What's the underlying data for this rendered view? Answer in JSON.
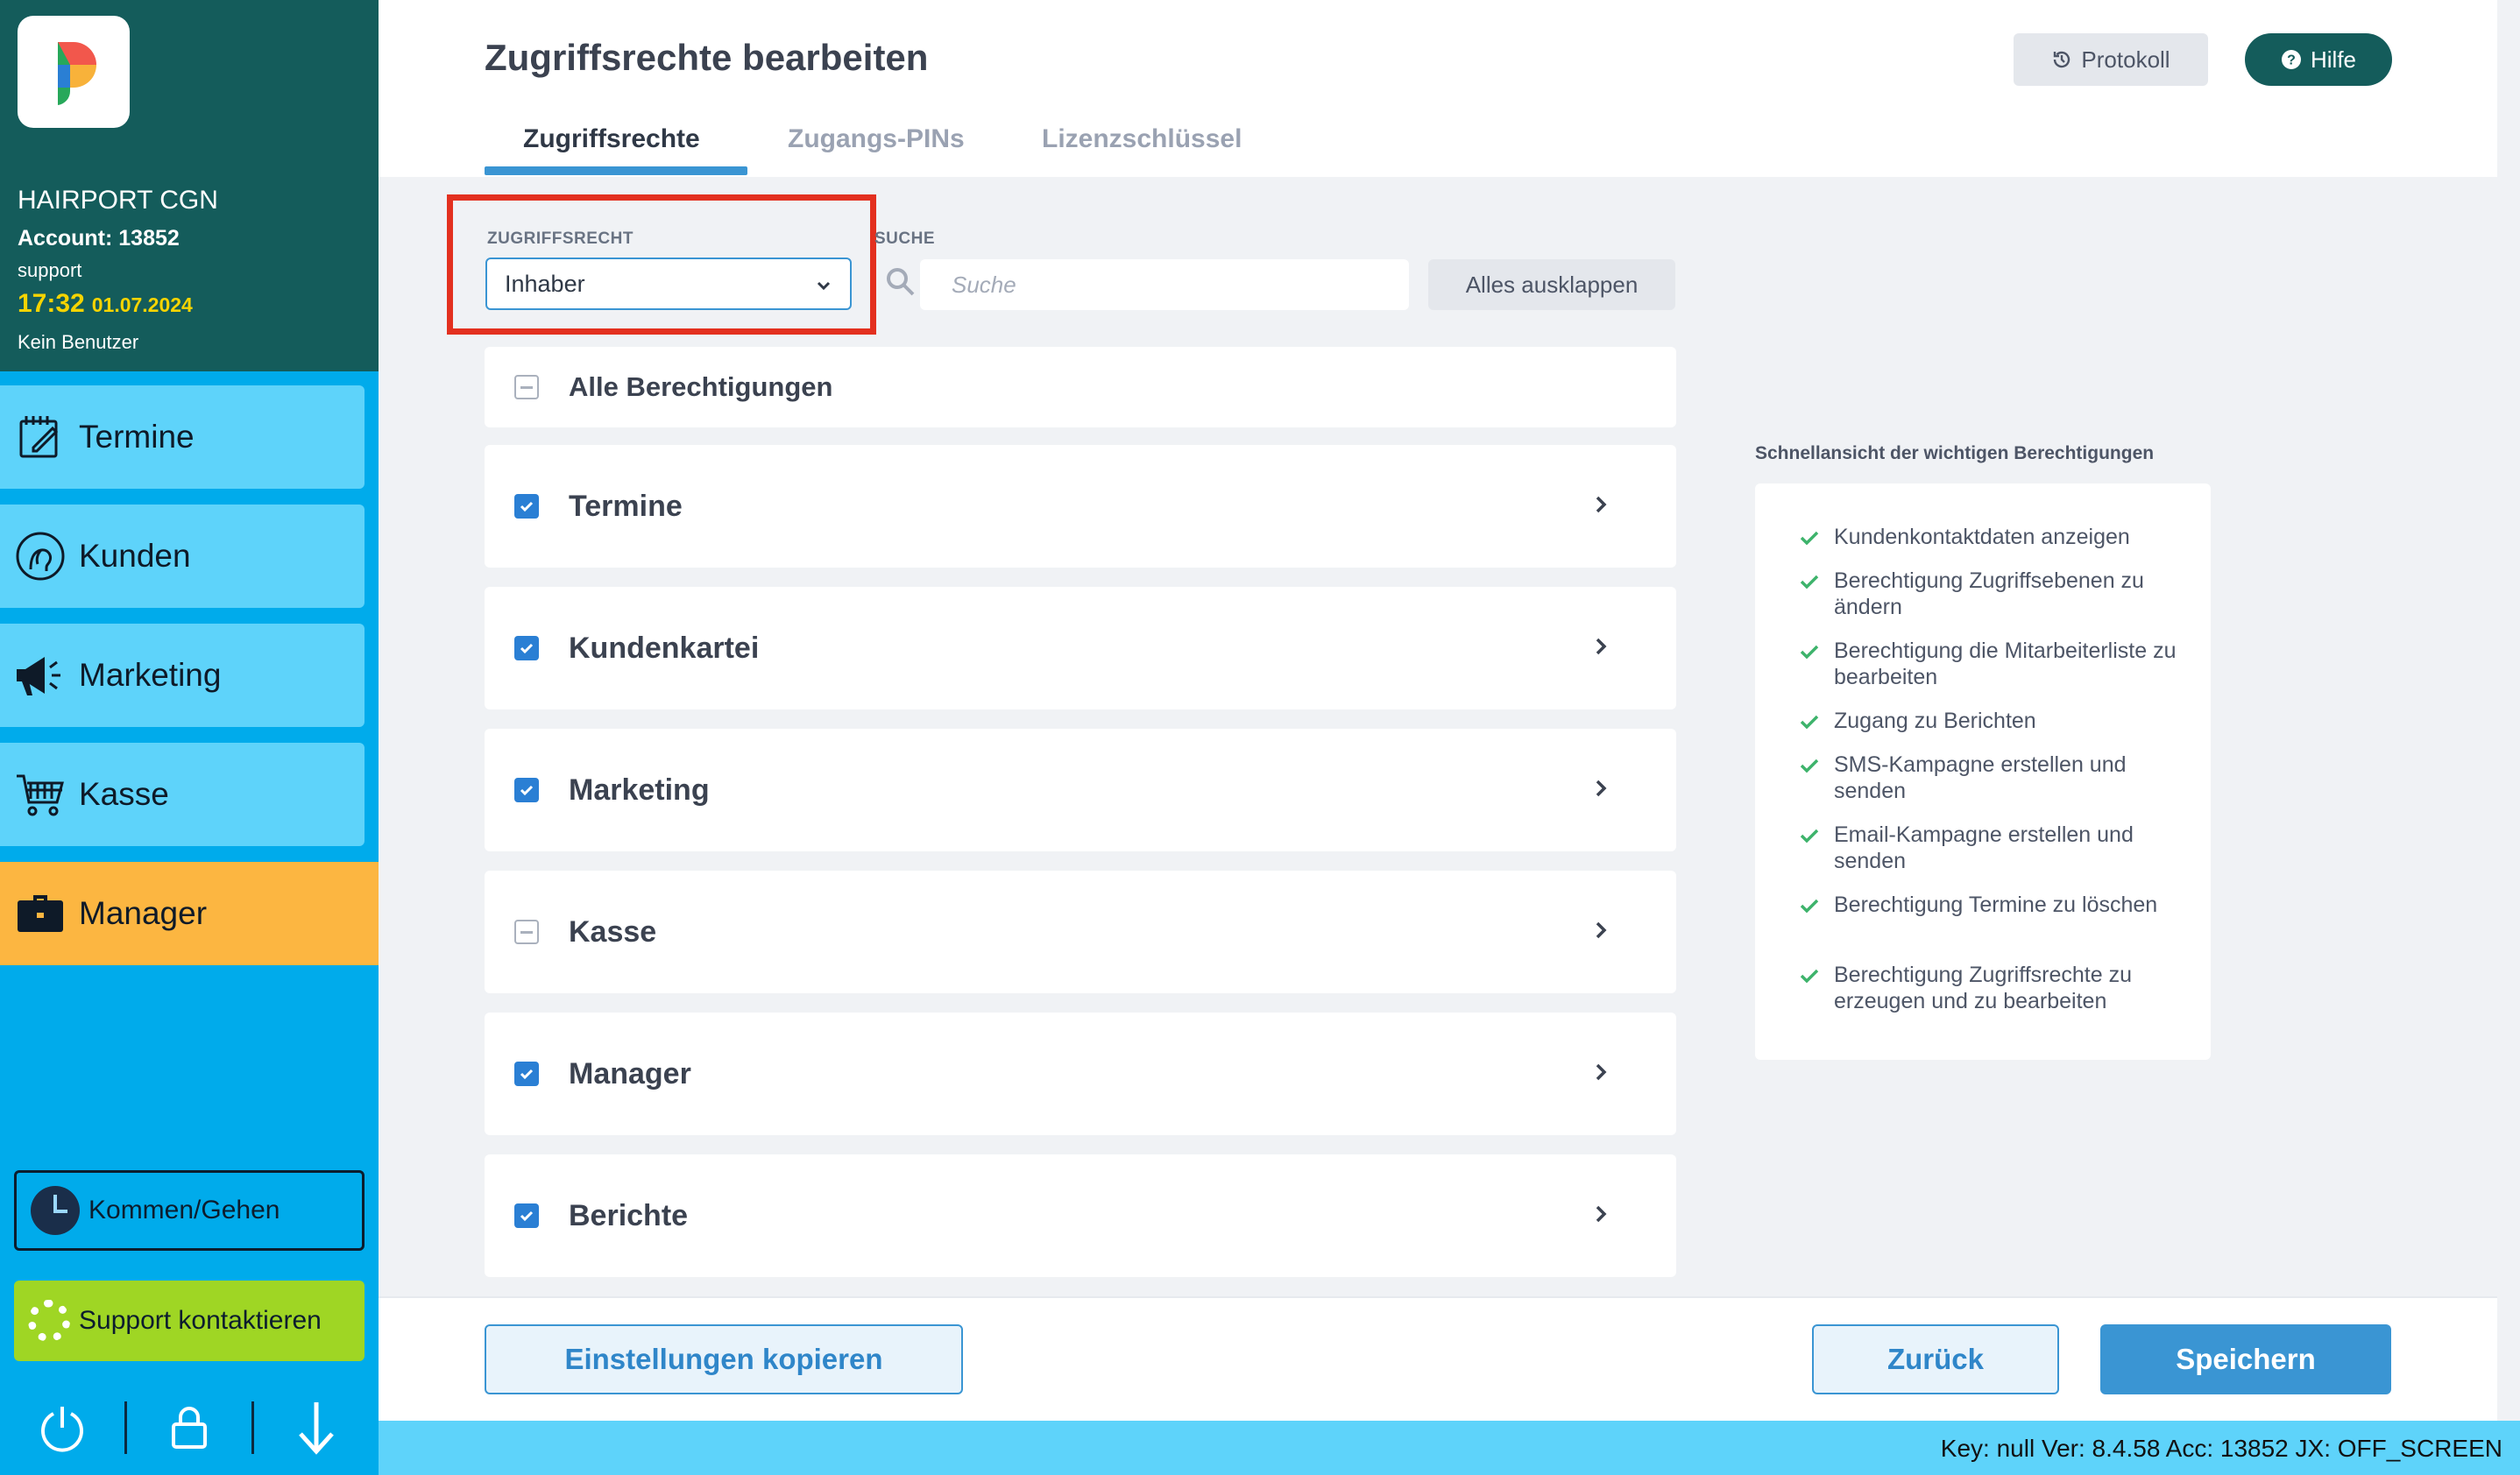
{
  "sidebar": {
    "account": {
      "salon_name": "HAIRPORT CGN",
      "account_line": "Account: 13852",
      "user": "support",
      "time": "17:32",
      "date": "01.07.2024",
      "employee": "Kein Benutzer"
    },
    "nav": [
      {
        "label": "Termine",
        "icon": "calendar-edit-icon"
      },
      {
        "label": "Kunden",
        "icon": "customer-head-icon"
      },
      {
        "label": "Marketing",
        "icon": "megaphone-icon"
      },
      {
        "label": "Kasse",
        "icon": "cart-icon"
      },
      {
        "label": "Manager",
        "icon": "briefcase-icon",
        "active": true
      }
    ],
    "kommen_label": "Kommen/Gehen",
    "support_label": "Support kontaktieren",
    "bottom_icons": [
      "power-icon",
      "lock-icon",
      "arrow-down-icon"
    ]
  },
  "header": {
    "title": "Zugriffsrechte bearbeiten",
    "tabs": [
      {
        "label": "Zugriffsrechte",
        "active": true
      },
      {
        "label": "Zugangs-PINs",
        "active": false
      },
      {
        "label": "Lizenzschlüssel",
        "active": false
      }
    ],
    "protokoll_label": "Protokoll",
    "hilfe_label": "Hilfe"
  },
  "filters": {
    "access_label": "ZUGRIFFSRECHT",
    "access_value": "Inhaber",
    "search_label": "SUCHE",
    "search_placeholder": "Suche",
    "expand_label": "Alles ausklappen"
  },
  "permissions": {
    "all_label": "Alle Berechtigungen",
    "all_state": "partial",
    "groups": [
      {
        "label": "Termine",
        "state": "checked"
      },
      {
        "label": "Kundenkartei",
        "state": "checked"
      },
      {
        "label": "Marketing",
        "state": "checked"
      },
      {
        "label": "Kasse",
        "state": "partial"
      },
      {
        "label": "Manager",
        "state": "checked"
      },
      {
        "label": "Berichte",
        "state": "checked"
      }
    ]
  },
  "quick_view": {
    "title": "Schnellansicht der wichtigen Berechtigungen",
    "items": [
      "Kundenkontaktdaten anzeigen",
      "Berechtigung Zugriffsebenen zu ändern",
      "Berechtigung die Mitarbeiterliste zu bearbeiten",
      "Zugang zu Berichten",
      "SMS-Kampagne erstellen und senden",
      "Email-Kampagne erstellen und senden",
      "Berechtigung Termine zu löschen",
      "Berechtigung Zugriffsrechte zu erzeugen und zu bearbeiten"
    ]
  },
  "footer": {
    "copy_label": "Einstellungen kopieren",
    "back_label": "Zurück",
    "save_label": "Speichern"
  },
  "statusbar": {
    "text": "Key: null Ver: 8.4.58 Acc: 13852  JX: OFF_SCREEN"
  },
  "colors": {
    "sidebar_top": "#145c5b",
    "sidebar_bg": "#00abeb",
    "nav_item": "#5ed3fa",
    "nav_active": "#fcb641",
    "accent": "#3a95d3",
    "checkbox": "#2a7fd4",
    "highlight_frame": "#e3301f",
    "support_button": "#9fd624",
    "time_color": "#f6d400"
  }
}
